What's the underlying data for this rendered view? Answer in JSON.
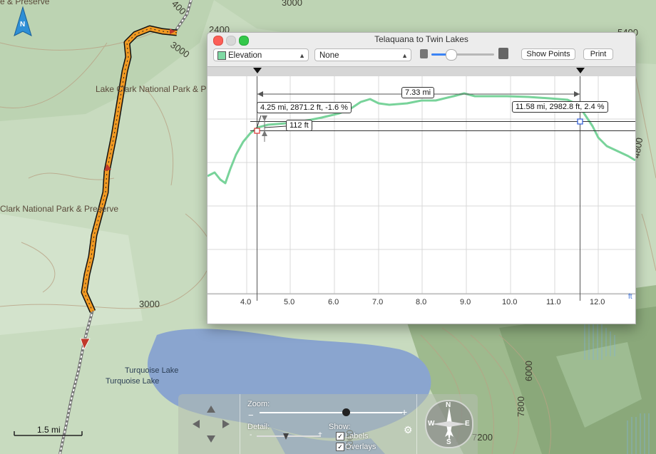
{
  "map": {
    "labels": {
      "top_left_park": "e & Preserve",
      "lake_clark_1": "Lake Clark National Park & P",
      "lake_clark_2": "Clark National Park & Preserve",
      "turquoise_lake_1": "Turquoise Lake",
      "turquoise_lake_2": "Turquoise Lake"
    },
    "contours": {
      "c2400": "2400",
      "c3000_top": "3000",
      "c3000_mid": "3000",
      "c3000_center": "3000",
      "c400": "400",
      "c5400": "5400",
      "c4800": "4800",
      "c6000": "6000",
      "c7800": "7800",
      "c7200": "7200",
      "c3000_bottom": "3000"
    },
    "north_label": "N",
    "scale_label": "1.5 mi"
  },
  "window": {
    "title": "Telaquana to Twin Lakes",
    "profile_select": "Elevation",
    "second_select": "None",
    "show_points_label": "Show Points",
    "print_label": "Print",
    "span_label": "7.33 mi",
    "left_marker_label": "4.25 mi, 2871.2 ft, -1.6 %",
    "right_marker_label": "11.58 mi, 2982.8 ft, 2.4 %",
    "delta_label": "112 ft",
    "x_ticks": [
      "4.0",
      "5.0",
      "6.0",
      "7.0",
      "8.0",
      "9.0",
      "10.0",
      "11.0",
      "12.0"
    ],
    "x_edge_label": "ft"
  },
  "controls": {
    "zoom_label": "Zoom:",
    "detail_label": "Detail:",
    "show_label": "Show:",
    "labels_option": "Labels",
    "overlays_option": "Overlays",
    "compass": {
      "n": "N",
      "s": "S",
      "w": "W",
      "e": "E"
    }
  },
  "colors": {
    "track": "#f29a22",
    "profile_line": "#78d39a",
    "lake": "#8aa5cf"
  }
}
